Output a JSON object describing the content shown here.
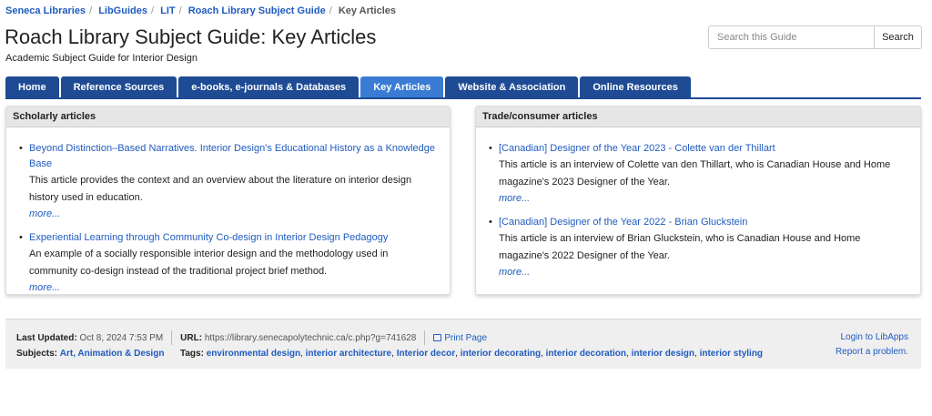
{
  "breadcrumb": {
    "items": [
      "Seneca Libraries",
      "LibGuides",
      "LIT",
      "Roach Library Subject Guide"
    ],
    "current": "Key Articles"
  },
  "page": {
    "title": "Roach Library Subject Guide: Key Articles",
    "subtitle": "Academic Subject Guide for Interior Design"
  },
  "search": {
    "placeholder": "Search this Guide",
    "button": "Search"
  },
  "tabs": [
    {
      "label": "Home"
    },
    {
      "label": "Reference Sources"
    },
    {
      "label": "e-books, e-journals & Databases"
    },
    {
      "label": "Key Articles"
    },
    {
      "label": "Website & Association"
    },
    {
      "label": "Online Resources"
    }
  ],
  "scholarly": {
    "heading": "Scholarly articles",
    "items": [
      {
        "title": "Beyond Distinction–Based Narratives. Interior Design's Educational History as a Knowledge Base",
        "desc": "This article provides the context and an overview about the literature on interior design history used in education.",
        "more": "more..."
      },
      {
        "title": "Experiential Learning through Community Co-design in Interior Design Pedagogy",
        "desc": "An example of a socially responsible interior design and the methodology used in community co-design instead of the traditional project brief method.",
        "more": "more..."
      }
    ]
  },
  "trade": {
    "heading": "Trade/consumer articles",
    "items": [
      {
        "title": "[Canadian] Designer of the Year 2023 - Colette van der Thillart",
        "desc": "This article is an interview of Colette van den Thillart, who is Canadian House and Home magazine's 2023 Designer of the Year.",
        "more": "more..."
      },
      {
        "title": "[Canadian] Designer of the Year 2022 - Brian Gluckstein",
        "desc": "This article is an interview of Brian Gluckstein, who is Canadian House and Home magazine's 2022 Designer of the Year.",
        "more": "more..."
      }
    ]
  },
  "footer": {
    "last_updated_label": "Last Updated:",
    "last_updated": "Oct 8, 2024 7:53 PM",
    "url_label": "URL:",
    "url": "https://library.senecapolytechnic.ca/c.php?g=741628",
    "print": "Print Page",
    "subjects_label": "Subjects:",
    "subjects": "Art, Animation & Design",
    "tags_label": "Tags:",
    "tags": [
      "environmental design",
      "interior architecture",
      "Interior decor",
      "interior decorating",
      "interior decoration",
      "interior design",
      "interior styling"
    ],
    "login": "Login to LibApps",
    "report": "Report a problem."
  },
  "icons": {
    "print": "printer-icon"
  },
  "colors": {
    "tab": "#1e4b94",
    "tab_active": "#3a7cd4",
    "link": "#1f5bbf"
  }
}
